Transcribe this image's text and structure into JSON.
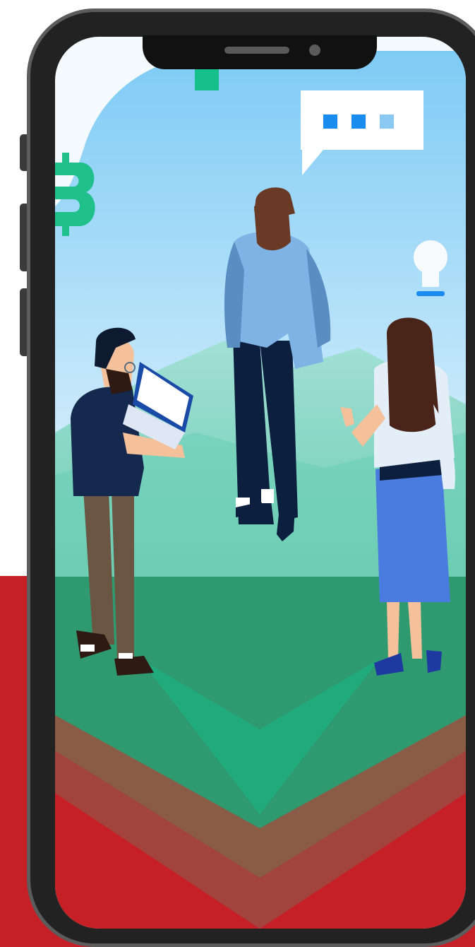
{
  "colors": {
    "background_white": "#ffffff",
    "background_red": "#c62026",
    "phone_frame": "#222222",
    "phone_bezel": "#5c5c5c",
    "sky_top": "#7ecbf5",
    "sky_bottom": "#e9f6fd",
    "hill": "#7fd3c1",
    "field": "#3a9871",
    "ground_highlight": "#16b886",
    "layer_brown": "#8a5b45",
    "bitcoin": "#20c08a",
    "chat_dots": "#1a8cf0",
    "shirt_navy": "#14294d",
    "shirt_blue": "#7fb3e6",
    "skirt_blue": "#4a7ce0",
    "hair_brown": "#4a2418",
    "skin": "#f4c19b"
  },
  "icons": [
    "bitcoin-icon",
    "chat-bubble-icon",
    "light-bulb-icon"
  ]
}
